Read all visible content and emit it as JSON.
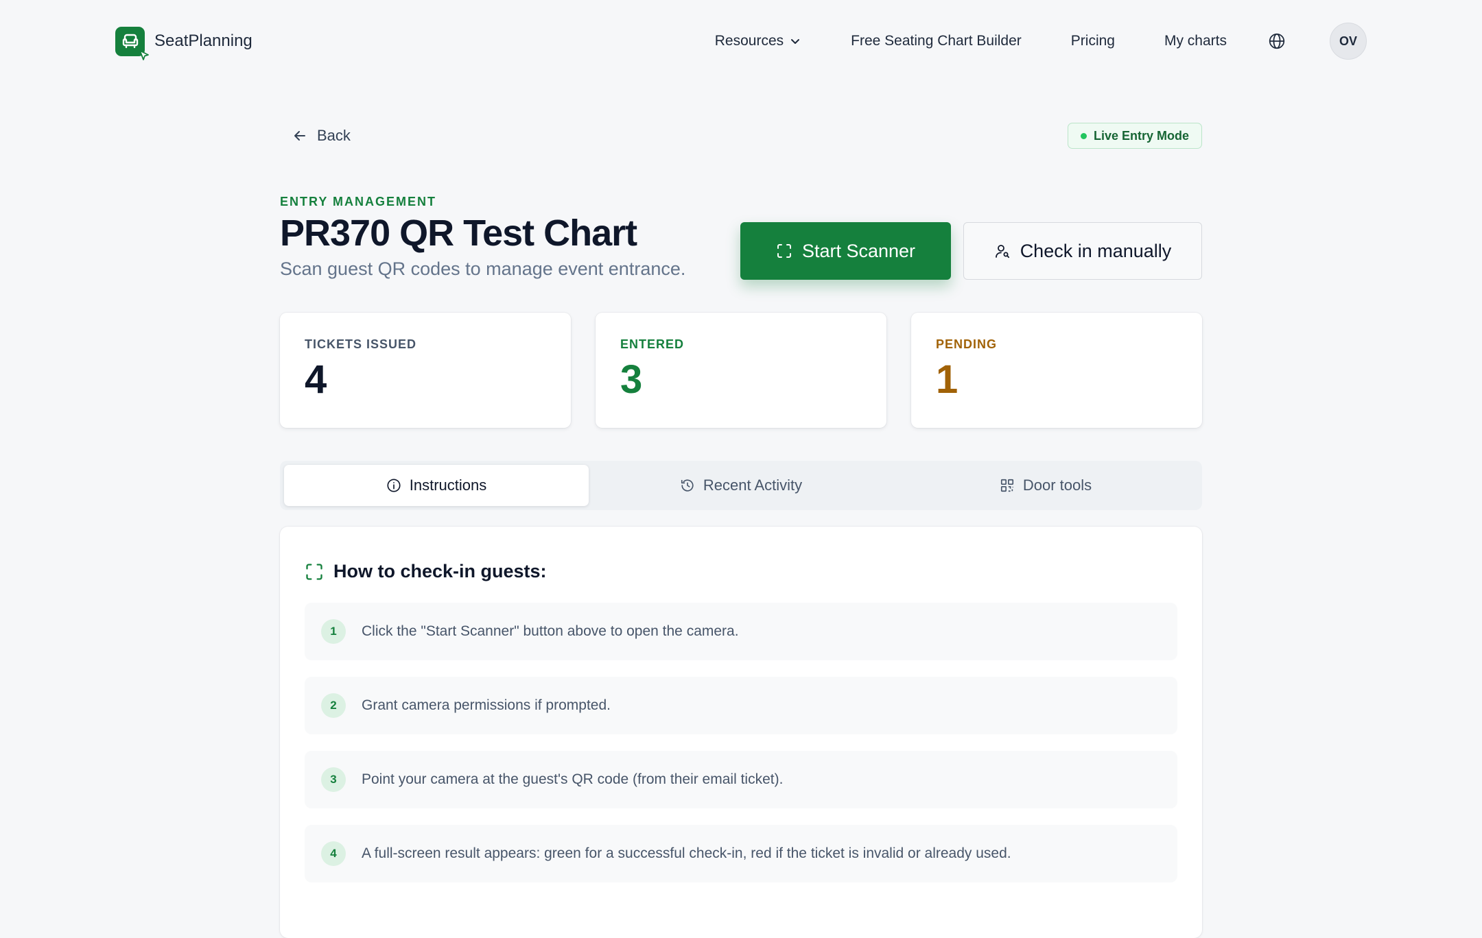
{
  "nav": {
    "brand": "SeatPlanning",
    "links": [
      "Resources",
      "Free Seating Chart Builder",
      "Pricing",
      "My charts"
    ],
    "avatar_initials": "OV"
  },
  "page": {
    "back_label": "Back",
    "live_badge": "Live Entry Mode",
    "eyebrow": "ENTRY MANAGEMENT",
    "title": "PR370 QR Test Chart",
    "subtitle": "Scan guest QR codes to manage event entrance.",
    "start_scanner_label": "Start Scanner",
    "check_in_manually_label": "Check in manually"
  },
  "stats": [
    {
      "label": "TICKETS ISSUED",
      "value": "4"
    },
    {
      "label": "ENTERED",
      "value": "3"
    },
    {
      "label": "PENDING",
      "value": "1"
    }
  ],
  "tabs": [
    {
      "label": "Instructions",
      "active": true
    },
    {
      "label": "Recent Activity",
      "active": false
    },
    {
      "label": "Door tools",
      "active": false
    }
  ],
  "instructions": {
    "title": "How to check-in guests:",
    "steps": [
      {
        "num": "1",
        "text": "Click the \"Start Scanner\" button above to open the camera."
      },
      {
        "num": "2",
        "text": "Grant camera permissions if prompted."
      },
      {
        "num": "3",
        "text": "Point your camera at the guest's QR code (from their email ticket)."
      },
      {
        "num": "4",
        "text": "A full-screen result appears: green for a successful check-in, red if the ticket is invalid or already used."
      }
    ]
  },
  "colors": {
    "brand_green": "#15803d",
    "pending_amber": "#a16207",
    "live_dot": "#22c55e"
  }
}
